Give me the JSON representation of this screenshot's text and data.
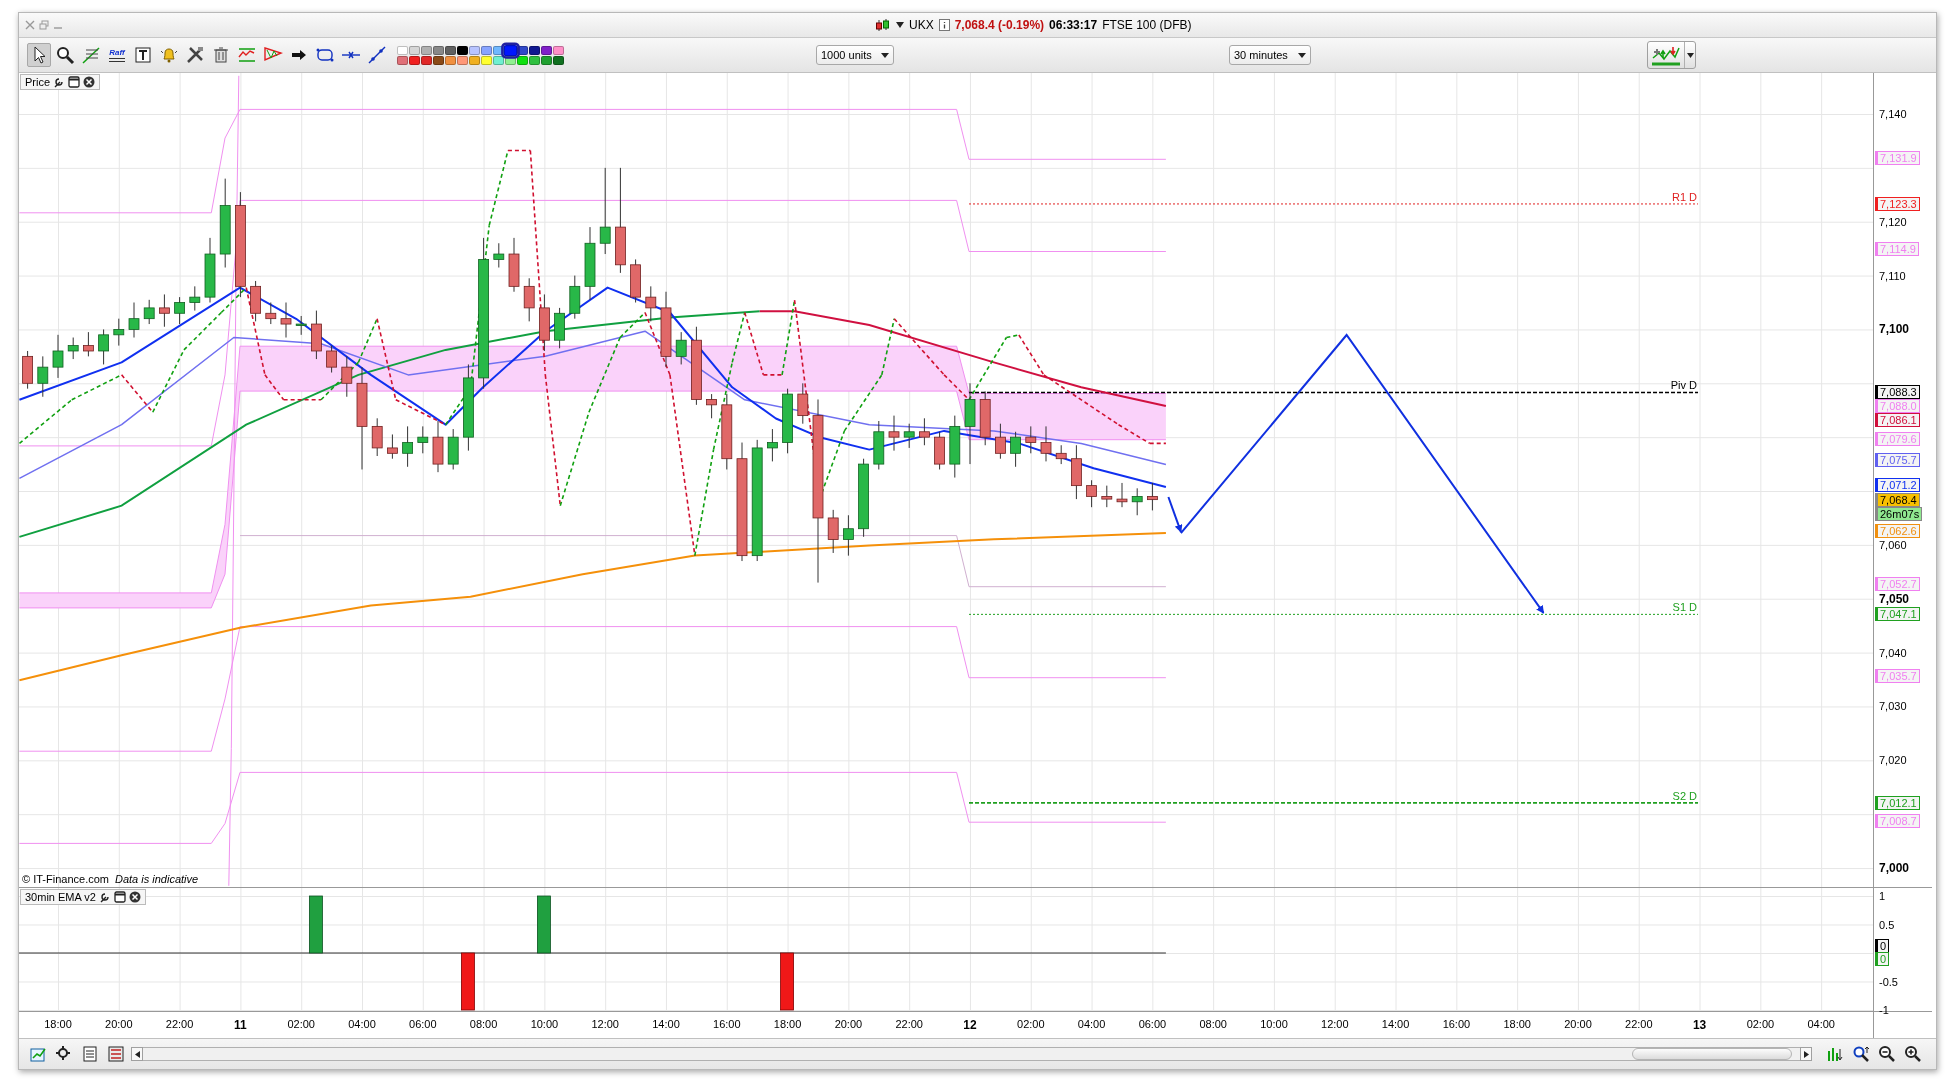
{
  "window": {
    "instrument": "UKX",
    "price": "7,068.4 (-0.19%)",
    "time": "06:33:17",
    "name": "FTSE 100 (DFB)"
  },
  "toolbar": {
    "tools": [
      {
        "kind": "pointer",
        "selected": true
      },
      {
        "kind": "zoom",
        "selected": false
      },
      {
        "kind": "trendline",
        "selected": false
      },
      {
        "kind": "raff",
        "label": "Raff",
        "selected": false
      },
      {
        "kind": "text",
        "selected": false
      },
      {
        "kind": "alarm",
        "selected": false
      },
      {
        "kind": "tools",
        "selected": false
      },
      {
        "kind": "trash",
        "selected": false
      },
      {
        "kind": "channel",
        "selected": false
      },
      {
        "kind": "triangle",
        "selected": false
      },
      {
        "kind": "arrow",
        "selected": false
      },
      {
        "kind": "shape",
        "selected": false
      },
      {
        "kind": "hline",
        "selected": false
      },
      {
        "kind": "line",
        "selected": false
      }
    ],
    "palette": [
      {
        "color": "#ffffff",
        "selected": false
      },
      {
        "color": "#d6d6d6",
        "selected": false
      },
      {
        "color": "#b0b0b0",
        "selected": false
      },
      {
        "color": "#888888",
        "selected": false
      },
      {
        "color": "#606060",
        "selected": false
      },
      {
        "color": "#000000",
        "selected": false
      },
      {
        "color": "#b8c4ff",
        "selected": false
      },
      {
        "color": "#88a4ff",
        "selected": false
      },
      {
        "color": "#70b8ff",
        "selected": false
      },
      {
        "color": "#0018ff",
        "selected": true
      },
      {
        "color": "#3048c8",
        "selected": false
      },
      {
        "color": "#101890",
        "selected": false
      },
      {
        "color": "#8020c8",
        "selected": false
      },
      {
        "color": "#ff90c8",
        "selected": false
      },
      {
        "color": "#e07078",
        "selected": false
      },
      {
        "color": "#f02020",
        "selected": false
      },
      {
        "color": "#e02828",
        "selected": false
      },
      {
        "color": "#8a4a18",
        "selected": false
      },
      {
        "color": "#f09040",
        "selected": false
      },
      {
        "color": "#ff9878",
        "selected": false
      },
      {
        "color": "#f0b020",
        "selected": false
      },
      {
        "color": "#ffff30",
        "selected": false
      },
      {
        "color": "#70f0d0",
        "selected": false
      },
      {
        "color": "#90f090",
        "selected": false
      },
      {
        "color": "#10e010",
        "selected": false
      },
      {
        "color": "#30c040",
        "selected": false
      },
      {
        "color": "#20a030",
        "selected": false
      },
      {
        "color": "#107020",
        "selected": false
      }
    ],
    "units": "1000 units",
    "interval": "30 minutes"
  },
  "price_panel": {
    "legend": "Price",
    "copyright": "© IT-Finance.com",
    "disclaimer": "Data is indicative",
    "pivots": [
      {
        "label": "R1 D",
        "color": "#e02020"
      },
      {
        "label": "Piv D",
        "color": "#000000"
      },
      {
        "label": "S1 D",
        "color": "#20a020"
      },
      {
        "label": "S2 D",
        "color": "#20a020"
      }
    ],
    "ticks": [
      {
        "label": "7,140",
        "major": false
      },
      {
        "label": "7,120",
        "major": false
      },
      {
        "label": "7,110",
        "major": false
      },
      {
        "label": "7,100",
        "major": true
      },
      {
        "label": "7,060",
        "major": false
      },
      {
        "label": "7,050",
        "major": true
      },
      {
        "label": "7,040",
        "major": false
      },
      {
        "label": "7,030",
        "major": false
      },
      {
        "label": "7,020",
        "major": false
      },
      {
        "label": "7,000",
        "major": true
      }
    ],
    "price_labels": [
      {
        "label": "7,131.9",
        "kind": "line",
        "color": "#f080f0"
      },
      {
        "label": "7,123.3",
        "kind": "line",
        "color": "#f02020"
      },
      {
        "label": "7,114.9",
        "kind": "line",
        "color": "#f080f0"
      },
      {
        "label": "7,088.3",
        "kind": "line",
        "color": "#000000"
      },
      {
        "label": "7,088.0",
        "kind": "line",
        "color": "#f080f0"
      },
      {
        "label": "7,086.1",
        "kind": "line",
        "color": "#d0103c"
      },
      {
        "label": "7,079.6",
        "kind": "line",
        "color": "#f080f0"
      },
      {
        "label": "7,075.7",
        "kind": "line",
        "color": "#6060f0"
      },
      {
        "label": "7,071.2",
        "kind": "line",
        "color": "#1030f0"
      },
      {
        "label": "7,068.4",
        "kind": "fill",
        "color": "#f8c000"
      },
      {
        "label": "26m07s",
        "kind": "timer",
        "color": "#90e890"
      },
      {
        "label": "7,062.6",
        "kind": "line",
        "color": "#f09010"
      },
      {
        "label": "7,052.7",
        "kind": "line",
        "color": "#f080f0"
      },
      {
        "label": "7,047.1",
        "kind": "line",
        "color": "#20a020"
      },
      {
        "label": "7,035.7",
        "kind": "line",
        "color": "#f080f0"
      },
      {
        "label": "7,012.1",
        "kind": "line",
        "color": "#20a020"
      },
      {
        "label": "7,008.7",
        "kind": "line",
        "color": "#f080f0"
      }
    ]
  },
  "indicator_panel": {
    "legend": "30min EMA v2",
    "ticks": [
      {
        "label": "1"
      },
      {
        "label": "0.5"
      },
      {
        "label": "-0.5"
      },
      {
        "label": "-1"
      }
    ],
    "value_labels": [
      {
        "label": "0",
        "color": "#000000"
      },
      {
        "label": "0",
        "color": "#20a020"
      }
    ]
  },
  "time_axis": [
    {
      "label": "18:00",
      "major": false
    },
    {
      "label": "20:00",
      "major": false
    },
    {
      "label": "22:00",
      "major": false
    },
    {
      "label": "11",
      "major": true
    },
    {
      "label": "02:00",
      "major": false
    },
    {
      "label": "04:00",
      "major": false
    },
    {
      "label": "06:00",
      "major": false
    },
    {
      "label": "08:00",
      "major": false
    },
    {
      "label": "10:00",
      "major": false
    },
    {
      "label": "12:00",
      "major": false
    },
    {
      "label": "14:00",
      "major": false
    },
    {
      "label": "16:00",
      "major": false
    },
    {
      "label": "18:00",
      "major": false
    },
    {
      "label": "20:00",
      "major": false
    },
    {
      "label": "22:00",
      "major": false
    },
    {
      "label": "12",
      "major": true
    },
    {
      "label": "02:00",
      "major": false
    },
    {
      "label": "04:00",
      "major": false
    },
    {
      "label": "06:00",
      "major": false
    },
    {
      "label": "08:00",
      "major": false
    },
    {
      "label": "10:00",
      "major": false
    },
    {
      "label": "12:00",
      "major": false
    },
    {
      "label": "14:00",
      "major": false
    },
    {
      "label": "16:00",
      "major": false
    },
    {
      "label": "18:00",
      "major": false
    },
    {
      "label": "20:00",
      "major": false
    },
    {
      "label": "22:00",
      "major": false
    },
    {
      "label": "13",
      "major": true
    },
    {
      "label": "02:00",
      "major": false
    },
    {
      "label": "04:00",
      "major": false
    }
  ]
}
